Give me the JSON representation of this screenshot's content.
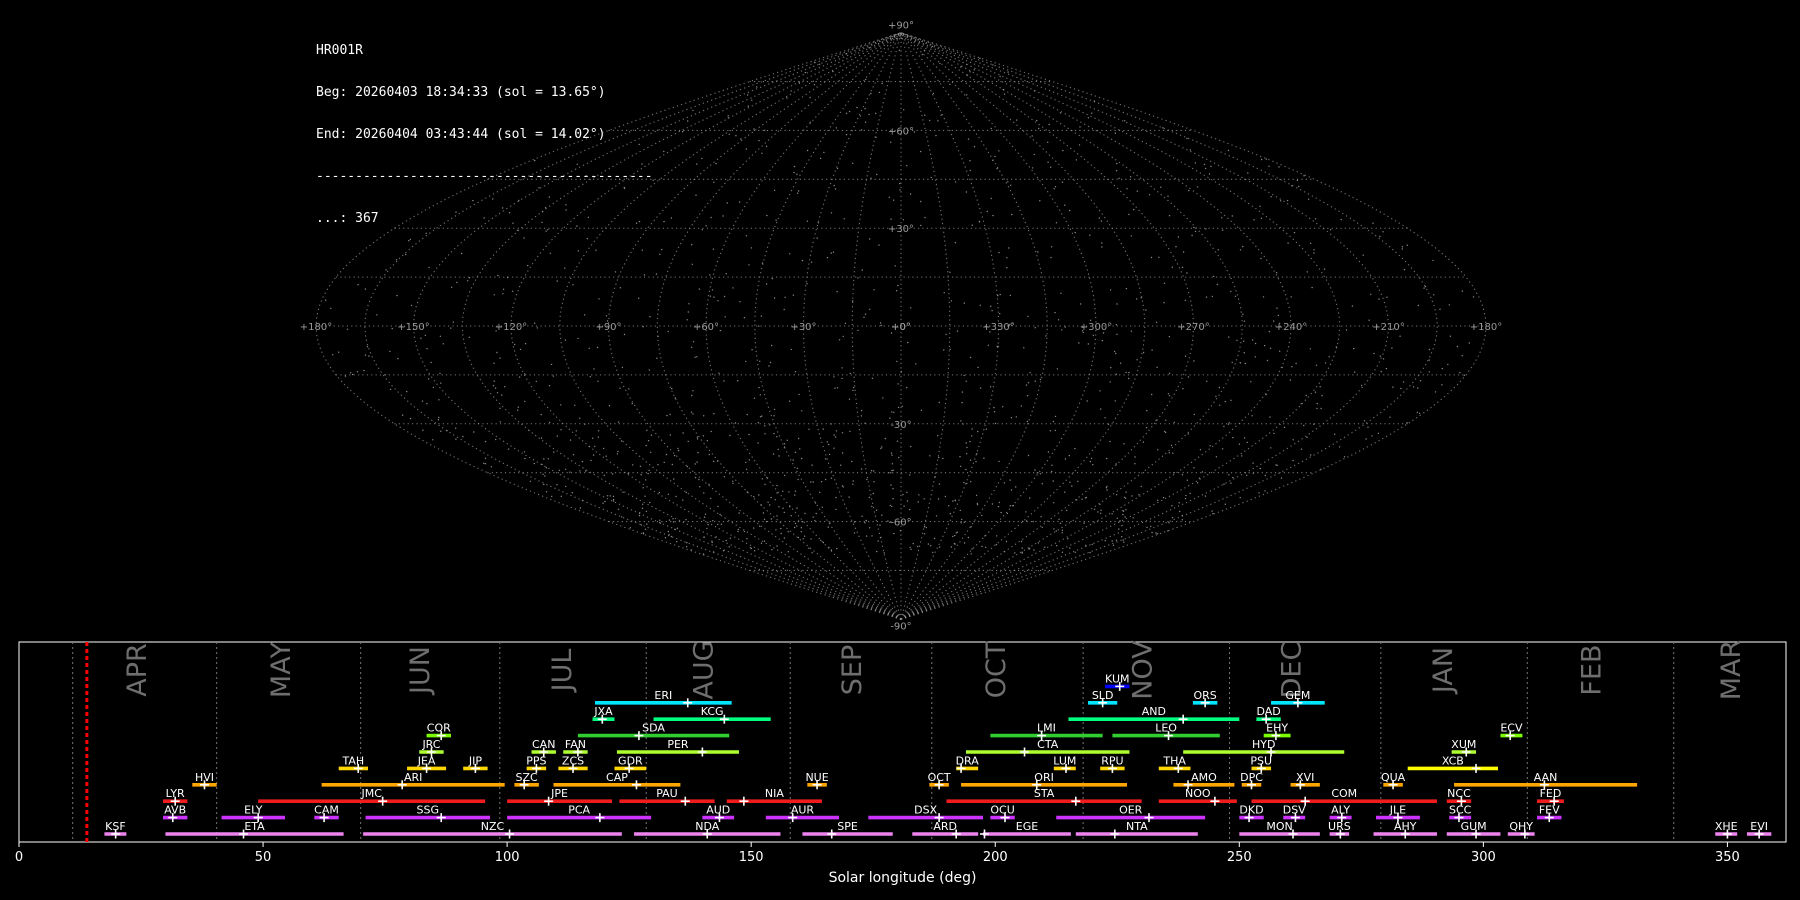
{
  "info": {
    "station": "HR001R",
    "begin": "Beg: 20260403 18:34:33 (sol = 13.65°)",
    "end": "End: 20260404 03:43:44 (sol = 14.02°)",
    "separator": "-------------------------------------------",
    "count": "...: 367"
  },
  "chart_data": [
    {
      "type": "scatter",
      "projection": "sinusoidal",
      "grid": true,
      "meridian_labels": [
        "+180°",
        "+150°",
        "+120°",
        "+90°",
        "+60°",
        "+30°",
        "+0°",
        "+330°",
        "+300°",
        "+270°",
        "+240°",
        "+210°",
        "+180°"
      ],
      "parallel_labels": [
        "+90°",
        "+60°",
        "+30°",
        "+0°",
        "-30°",
        "-60°",
        "-90°"
      ]
    },
    {
      "type": "bar",
      "xlabel": "Solar longitude (deg)",
      "xlim": [
        0,
        362
      ],
      "ylim": [
        0,
        10
      ],
      "xticks": [
        0,
        50,
        100,
        150,
        200,
        250,
        300,
        350
      ],
      "current_sol": 13.9,
      "months": [
        {
          "name": "APR",
          "start": 11.0,
          "center": 24.5
        },
        {
          "name": "MAY",
          "start": 40.5,
          "center": 54.0
        },
        {
          "name": "JUN",
          "start": 70.0,
          "center": 82.5
        },
        {
          "name": "JUL",
          "start": 98.5,
          "center": 111.5
        },
        {
          "name": "AUG",
          "start": 128.5,
          "center": 140.5
        },
        {
          "name": "SEP",
          "start": 158.0,
          "center": 171.0
        },
        {
          "name": "OCT",
          "start": 187.0,
          "center": 200.5
        },
        {
          "name": "NOV",
          "start": 218.0,
          "center": 230.5
        },
        {
          "name": "DEC",
          "start": 248.0,
          "center": 261.0
        },
        {
          "name": "JAN",
          "start": 279.0,
          "center": 292.0
        },
        {
          "name": "FEB",
          "start": 309.0,
          "center": 322.5
        },
        {
          "name": "MAR",
          "start": 339.0,
          "center": 351.0
        }
      ],
      "showers": [
        {
          "code": "KSF",
          "start": 17.5,
          "end": 22.0,
          "peak": 19.8,
          "row": 0,
          "color": "#ee82ee"
        },
        {
          "code": "ETA",
          "start": 30.0,
          "end": 66.5,
          "peak": 46.0,
          "row": 0,
          "color": "#ee82ee"
        },
        {
          "code": "NZC",
          "start": 70.5,
          "end": 123.5,
          "peak": 100.5,
          "row": 0,
          "color": "#ee82ee"
        },
        {
          "code": "NDA",
          "start": 126.0,
          "end": 156.0,
          "peak": 141.0,
          "row": 0,
          "color": "#ee82ee"
        },
        {
          "code": "SPE",
          "start": 160.5,
          "end": 179.0,
          "peak": 166.5,
          "row": 0,
          "color": "#ee82ee"
        },
        {
          "code": "ARD",
          "start": 183.0,
          "end": 196.5,
          "peak": 192.0,
          "row": 0,
          "color": "#ee82ee"
        },
        {
          "code": "EGE",
          "start": 197.5,
          "end": 215.5,
          "peak": 197.8,
          "row": 0,
          "color": "#ee82ee"
        },
        {
          "code": "NTA",
          "start": 216.5,
          "end": 241.5,
          "peak": 224.5,
          "row": 0,
          "color": "#ee82ee"
        },
        {
          "code": "MON",
          "start": 250.0,
          "end": 266.5,
          "peak": 261.0,
          "row": 0,
          "color": "#ee82ee"
        },
        {
          "code": "URS",
          "start": 268.5,
          "end": 272.5,
          "peak": 270.7,
          "row": 0,
          "color": "#ee82ee"
        },
        {
          "code": "AHY",
          "start": 277.5,
          "end": 290.5,
          "peak": 284.0,
          "row": 0,
          "color": "#ee82ee"
        },
        {
          "code": "GUM",
          "start": 292.5,
          "end": 303.5,
          "peak": 298.5,
          "row": 0,
          "color": "#ee82ee"
        },
        {
          "code": "QHY",
          "start": 305.0,
          "end": 310.5,
          "peak": 308.5,
          "row": 0,
          "color": "#ee82ee"
        },
        {
          "code": "XHE",
          "start": 347.5,
          "end": 352.0,
          "peak": 350.0,
          "row": 0,
          "color": "#ee82ee"
        },
        {
          "code": "EVI",
          "start": 354.0,
          "end": 359.0,
          "peak": 356.5,
          "row": 0,
          "color": "#ee82ee"
        },
        {
          "code": "AVB",
          "start": 29.5,
          "end": 34.5,
          "peak": 31.5,
          "row": 1,
          "color": "#cc33ff"
        },
        {
          "code": "ELY",
          "start": 41.5,
          "end": 54.5,
          "peak": 49.0,
          "row": 1,
          "color": "#cc33ff"
        },
        {
          "code": "CAM",
          "start": 60.5,
          "end": 65.5,
          "peak": 62.5,
          "row": 1,
          "color": "#cc33ff"
        },
        {
          "code": "SSG",
          "start": 71.0,
          "end": 96.5,
          "peak": 86.5,
          "row": 1,
          "color": "#cc33ff"
        },
        {
          "code": "PCA",
          "start": 100.0,
          "end": 129.5,
          "peak": 119.0,
          "row": 1,
          "color": "#cc33ff"
        },
        {
          "code": "AUD",
          "start": 140.0,
          "end": 146.5,
          "peak": 143.5,
          "row": 1,
          "color": "#cc33ff"
        },
        {
          "code": "AUR",
          "start": 153.0,
          "end": 168.0,
          "peak": 158.5,
          "row": 1,
          "color": "#cc33ff"
        },
        {
          "code": "DSX",
          "start": 174.0,
          "end": 197.5,
          "peak": 188.5,
          "row": 1,
          "color": "#cc33ff"
        },
        {
          "code": "OCU",
          "start": 199.0,
          "end": 204.0,
          "peak": 202.0,
          "row": 1,
          "color": "#cc33ff"
        },
        {
          "code": "OER",
          "start": 212.5,
          "end": 243.0,
          "peak": 231.5,
          "row": 1,
          "color": "#cc33ff"
        },
        {
          "code": "DKD",
          "start": 250.0,
          "end": 255.0,
          "peak": 252.0,
          "row": 1,
          "color": "#cc33ff"
        },
        {
          "code": "DSV",
          "start": 259.0,
          "end": 263.5,
          "peak": 261.5,
          "row": 1,
          "color": "#cc33ff"
        },
        {
          "code": "ALY",
          "start": 268.5,
          "end": 273.0,
          "peak": 271.0,
          "row": 1,
          "color": "#cc33ff"
        },
        {
          "code": "JLE",
          "start": 278.0,
          "end": 287.0,
          "peak": 282.5,
          "row": 1,
          "color": "#cc33ff"
        },
        {
          "code": "SCC",
          "start": 293.0,
          "end": 297.5,
          "peak": 295.0,
          "row": 1,
          "color": "#cc33ff"
        },
        {
          "code": "FEV",
          "start": 311.0,
          "end": 316.0,
          "peak": 313.5,
          "row": 1,
          "color": "#cc33ff"
        },
        {
          "code": "LYR",
          "start": 29.5,
          "end": 34.5,
          "peak": 32.0,
          "row": 2,
          "color": "#ee1c1c"
        },
        {
          "code": "JMC",
          "start": 49.0,
          "end": 95.5,
          "peak": 74.5,
          "row": 2,
          "color": "#ee1c1c"
        },
        {
          "code": "JPE",
          "start": 100.0,
          "end": 121.5,
          "peak": 108.5,
          "row": 2,
          "color": "#ee1c1c"
        },
        {
          "code": "PAU",
          "start": 123.0,
          "end": 142.5,
          "peak": 136.5,
          "row": 2,
          "color": "#ee1c1c"
        },
        {
          "code": "NIA",
          "start": 145.0,
          "end": 164.5,
          "peak": 148.5,
          "row": 2,
          "color": "#ee1c1c"
        },
        {
          "code": "STA",
          "start": 190.0,
          "end": 230.0,
          "peak": 216.5,
          "row": 2,
          "color": "#ee1c1c"
        },
        {
          "code": "NOO",
          "start": 233.5,
          "end": 249.5,
          "peak": 245.0,
          "row": 2,
          "color": "#ee1c1c"
        },
        {
          "code": "COM",
          "start": 252.5,
          "end": 290.5,
          "peak": 263.5,
          "row": 2,
          "color": "#ee1c1c"
        },
        {
          "code": "NCC",
          "start": 292.5,
          "end": 297.5,
          "peak": 295.5,
          "row": 2,
          "color": "#ee1c1c"
        },
        {
          "code": "FED",
          "start": 311.0,
          "end": 316.5,
          "peak": 314.5,
          "row": 2,
          "color": "#ee1c1c"
        },
        {
          "code": "HVI",
          "start": 35.5,
          "end": 40.5,
          "peak": 38.0,
          "row": 3,
          "color": "#ffa500"
        },
        {
          "code": "ARI",
          "start": 62.0,
          "end": 99.5,
          "peak": 78.5,
          "row": 3,
          "color": "#ffa500"
        },
        {
          "code": "SZC",
          "start": 101.5,
          "end": 106.5,
          "peak": 103.5,
          "row": 3,
          "color": "#ffa500"
        },
        {
          "code": "CAP",
          "start": 109.5,
          "end": 135.5,
          "peak": 126.5,
          "row": 3,
          "color": "#ffa500"
        },
        {
          "code": "NUE",
          "start": 161.5,
          "end": 165.5,
          "peak": 163.5,
          "row": 3,
          "color": "#ffa500"
        },
        {
          "code": "OCT",
          "start": 186.5,
          "end": 190.5,
          "peak": 188.5,
          "row": 3,
          "color": "#ffa500"
        },
        {
          "code": "ORI",
          "start": 193.0,
          "end": 227.0,
          "peak": 208.5,
          "row": 3,
          "color": "#ffa500"
        },
        {
          "code": "AMO",
          "start": 236.5,
          "end": 249.0,
          "peak": 239.5,
          "row": 3,
          "color": "#ffa500"
        },
        {
          "code": "DPC",
          "start": 250.5,
          "end": 254.5,
          "peak": 252.5,
          "row": 3,
          "color": "#ffa500"
        },
        {
          "code": "XVI",
          "start": 260.5,
          "end": 266.5,
          "peak": 262.5,
          "row": 3,
          "color": "#ffa500"
        },
        {
          "code": "QUA",
          "start": 279.5,
          "end": 283.5,
          "peak": 281.5,
          "row": 3,
          "color": "#ffa500"
        },
        {
          "code": "AAN",
          "start": 294.0,
          "end": 331.5,
          "peak": 312.5,
          "row": 3,
          "color": "#ffa500"
        },
        {
          "code": "TAH",
          "start": 65.5,
          "end": 71.5,
          "peak": 69.5,
          "row": 4,
          "color": "#ffd700"
        },
        {
          "code": "JEA",
          "start": 79.5,
          "end": 87.5,
          "peak": 83.5,
          "row": 4,
          "color": "#ffd700"
        },
        {
          "code": "JIP",
          "start": 91.0,
          "end": 96.0,
          "peak": 93.5,
          "row": 4,
          "color": "#ffd700"
        },
        {
          "code": "PPS",
          "start": 104.0,
          "end": 108.0,
          "peak": 106.0,
          "row": 4,
          "color": "#ffd700"
        },
        {
          "code": "ZCS",
          "start": 110.5,
          "end": 116.5,
          "peak": 113.5,
          "row": 4,
          "color": "#ffd700"
        },
        {
          "code": "GDR",
          "start": 122.0,
          "end": 128.5,
          "peak": 125.0,
          "row": 4,
          "color": "#ffd700"
        },
        {
          "code": "DRA",
          "start": 192.0,
          "end": 196.5,
          "peak": 193.0,
          "row": 4,
          "color": "#ffd700"
        },
        {
          "code": "LUM",
          "start": 212.0,
          "end": 216.5,
          "peak": 214.5,
          "row": 4,
          "color": "#ffd700"
        },
        {
          "code": "RPU",
          "start": 221.5,
          "end": 226.5,
          "peak": 224.0,
          "row": 4,
          "color": "#ffd700"
        },
        {
          "code": "THA",
          "start": 233.5,
          "end": 240.0,
          "peak": 237.5,
          "row": 4,
          "color": "#ffd700"
        },
        {
          "code": "PSU",
          "start": 252.5,
          "end": 256.5,
          "peak": 254.5,
          "row": 4,
          "color": "#ffd700"
        },
        {
          "code": "XCB",
          "start": 284.5,
          "end": 303.0,
          "peak": 298.5,
          "row": 4,
          "color": "#ffff00"
        },
        {
          "code": "JRC",
          "start": 82.0,
          "end": 87.0,
          "peak": 84.5,
          "row": 5,
          "color": "#adff2f"
        },
        {
          "code": "CAN",
          "start": 105.0,
          "end": 110.0,
          "peak": 107.5,
          "row": 5,
          "color": "#adff2f"
        },
        {
          "code": "FAN",
          "start": 111.5,
          "end": 116.5,
          "peak": 114.5,
          "row": 5,
          "color": "#adff2f"
        },
        {
          "code": "PER",
          "start": 122.5,
          "end": 147.5,
          "peak": 140.0,
          "row": 5,
          "color": "#adff2f"
        },
        {
          "code": "CTA",
          "start": 194.0,
          "end": 227.5,
          "peak": 206.0,
          "row": 5,
          "color": "#adff2f"
        },
        {
          "code": "HYD",
          "start": 238.5,
          "end": 271.5,
          "peak": 256.5,
          "row": 5,
          "color": "#adff2f"
        },
        {
          "code": "XUM",
          "start": 293.5,
          "end": 298.5,
          "peak": 296.5,
          "row": 5,
          "color": "#adff2f"
        },
        {
          "code": "COR",
          "start": 83.5,
          "end": 88.5,
          "peak": 86.5,
          "row": 6,
          "color": "#7cfc00"
        },
        {
          "code": "SDA",
          "start": 114.5,
          "end": 145.5,
          "peak": 127.0,
          "row": 6,
          "color": "#32cd32"
        },
        {
          "code": "LMI",
          "start": 199.0,
          "end": 222.0,
          "peak": 209.5,
          "row": 6,
          "color": "#32cd32"
        },
        {
          "code": "LEO",
          "start": 224.0,
          "end": 246.0,
          "peak": 235.5,
          "row": 6,
          "color": "#32cd32"
        },
        {
          "code": "EHY",
          "start": 255.0,
          "end": 260.5,
          "peak": 257.5,
          "row": 6,
          "color": "#7cfc00"
        },
        {
          "code": "ECV",
          "start": 303.5,
          "end": 308.0,
          "peak": 305.5,
          "row": 6,
          "color": "#7cfc00"
        },
        {
          "code": "JXA",
          "start": 117.5,
          "end": 122.0,
          "peak": 119.5,
          "row": 7,
          "color": "#00ff7f"
        },
        {
          "code": "KCG",
          "start": 130.0,
          "end": 154.0,
          "peak": 144.5,
          "row": 7,
          "color": "#00ff7f"
        },
        {
          "code": "AND",
          "start": 215.0,
          "end": 250.0,
          "peak": 238.5,
          "row": 7,
          "color": "#00ff7f"
        },
        {
          "code": "DAD",
          "start": 253.5,
          "end": 258.5,
          "peak": 255.5,
          "row": 7,
          "color": "#00ff7f"
        },
        {
          "code": "ERI",
          "start": 118.0,
          "end": 146.0,
          "peak": 137.0,
          "row": 8,
          "color": "#00e5ff"
        },
        {
          "code": "SLD",
          "start": 219.0,
          "end": 225.0,
          "peak": 222.0,
          "row": 8,
          "color": "#00e5ff"
        },
        {
          "code": "ORS",
          "start": 240.5,
          "end": 245.5,
          "peak": 243.0,
          "row": 8,
          "color": "#00e5ff"
        },
        {
          "code": "GEM",
          "start": 256.5,
          "end": 267.5,
          "peak": 262.0,
          "row": 8,
          "color": "#00e5ff"
        },
        {
          "code": "KUM",
          "start": 222.5,
          "end": 227.5,
          "peak": 225.5,
          "row": 9,
          "color": "#0000ff"
        }
      ]
    }
  ]
}
